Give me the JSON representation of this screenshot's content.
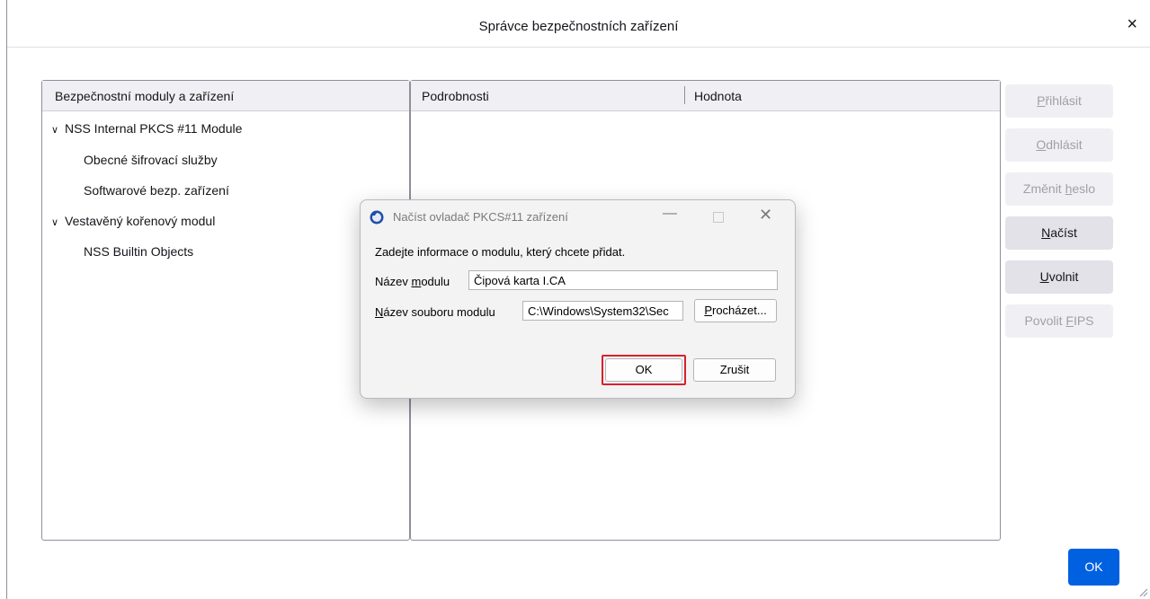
{
  "window": {
    "title": "Správce bezpečnostních zařízení",
    "close_glyph": "×"
  },
  "tree": {
    "header": "Bezpečnostní moduly a zařízení",
    "items": [
      {
        "label": "NSS Internal PKCS #11 Module",
        "expanded": true
      },
      {
        "label": "Obecné šifrovací služby"
      },
      {
        "label": "Softwarové bezp. zařízení"
      },
      {
        "label": "Vestavěný kořenový modul",
        "expanded": true
      },
      {
        "label": "NSS Builtin Objects"
      }
    ]
  },
  "details": {
    "col_details": "Podrobnosti",
    "col_value": "Hodnota"
  },
  "side_buttons": {
    "login": {
      "pre": "",
      "u": "P",
      "post": "řihlásit",
      "enabled": false
    },
    "logout": {
      "pre": "",
      "u": "O",
      "post": "dhlásit",
      "enabled": false
    },
    "change_password": {
      "pre": "Změnit ",
      "u": "h",
      "post": "eslo",
      "enabled": false
    },
    "load": {
      "pre": "",
      "u": "N",
      "post": "ačíst",
      "enabled": true
    },
    "unload": {
      "pre": "",
      "u": "U",
      "post": "volnit",
      "enabled": true
    },
    "enable_fips": {
      "pre": "Povolit ",
      "u": "F",
      "post": "IPS",
      "enabled": false
    }
  },
  "ok_button": "OK",
  "dialog": {
    "title": "Načíst ovladač PKCS#11 zařízení",
    "instruction": "Zadejte informace o modulu, který chcete přidat.",
    "module_name_label": {
      "pre": "Název ",
      "u": "m",
      "post": "odulu"
    },
    "module_name_value": "Čipová karta I.CA",
    "module_file_label": {
      "pre": "",
      "u": "N",
      "post": "ázev souboru modulu"
    },
    "module_file_value": "C:\\Windows\\System32\\Sec",
    "browse": {
      "pre": "",
      "u": "P",
      "post": "rocházet..."
    },
    "ok": "OK",
    "cancel": "Zrušit",
    "highlight_color": "#d9202e"
  },
  "colors": {
    "accent": "#0061e0",
    "button_bg": "#e2e2e8",
    "disabled_text": "#9f9fa8"
  }
}
